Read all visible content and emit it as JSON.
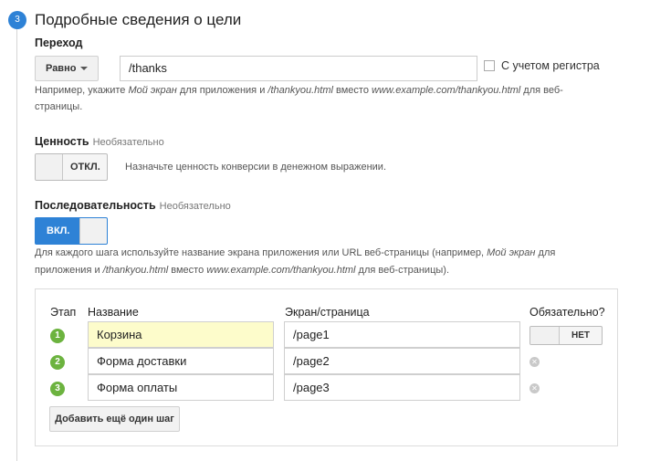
{
  "section": {
    "step_number": "3",
    "title": "Подробные сведения о цели"
  },
  "destination": {
    "label": "Переход",
    "match_type": "Равно",
    "value": "/thanks",
    "case_sensitive_label": "С учетом регистра",
    "help_line1_a": "Например, укажите ",
    "help_line1_b": "Мой экран",
    "help_line1_c": " для приложения и ",
    "help_line1_d": "/thankyou.html",
    "help_line1_e": " вместо ",
    "help_line1_f": "www.example.com/thankyou.html",
    "help_line1_g": " для веб-",
    "help_line2": "страницы."
  },
  "value": {
    "label": "Ценность",
    "optional": "Необязательно",
    "toggle_label": "ОТКЛ.",
    "help": "Назначьте ценность конверсии в денежном выражении."
  },
  "funnel": {
    "label": "Последовательность",
    "optional": "Необязательно",
    "toggle_label": "ВКЛ.",
    "help_a": "Для каждого шага используйте название экрана приложения или URL веб-страницы (например, ",
    "help_b": "Мой экран",
    "help_c": " для",
    "help_d": "приложения и ",
    "help_e": "/thankyou.html",
    "help_f": " вместо ",
    "help_g": "www.example.com/thankyou.html",
    "help_h": " для веб-страницы).",
    "columns": {
      "step": "Этап",
      "name": "Название",
      "screen": "Экран/страница",
      "required": "Обязательно?"
    },
    "rows": [
      {
        "num": "1",
        "name": "Корзина",
        "page": "/page1"
      },
      {
        "num": "2",
        "name": "Форма доставки",
        "page": "/page2"
      },
      {
        "num": "3",
        "name": "Форма оплаты",
        "page": "/page3"
      }
    ],
    "required_toggle": "НЕТ",
    "add_step_label": "Добавить ещё один шаг"
  },
  "colors": {
    "accent": "#2e82d6",
    "step_green": "#6cb33f",
    "highlight_input": "#fdfccb"
  },
  "icons": {
    "dropdown": "caret-down-icon",
    "remove": "remove-x-icon"
  }
}
